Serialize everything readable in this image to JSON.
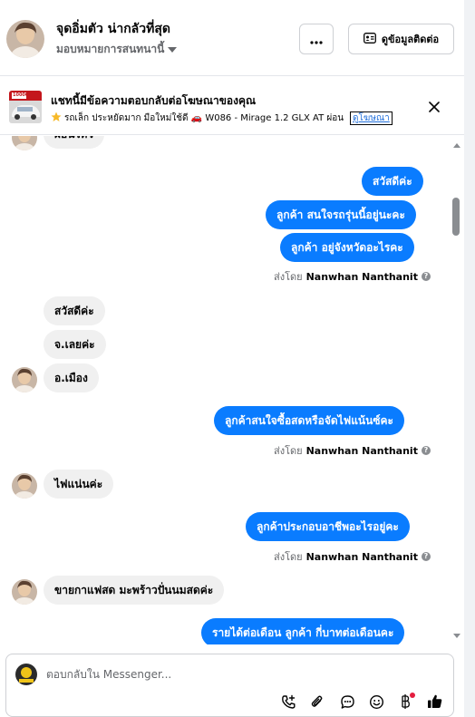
{
  "header": {
    "contact_name": "จุดอิ่มตัว น่ากลัวที่สุด",
    "assign_label": "มอบหมายการสนทนานี้",
    "more_label": "···",
    "contact_info_label": "ดูข้อมูลติดต่อ"
  },
  "ad_banner": {
    "title": "แชทนี้มีข้อความตอบกลับต่อโฆษณาของคุณ",
    "description": "รถเล็ก ประหยัดมาก มือใหม่ใช้ดี 🚗 W086 - Mirage 1.2 GLX AT ผ่อน ...",
    "link_label": "ดูโฆษณา",
    "thumb_text": "10000"
  },
  "messages": [
    {
      "id": "m0",
      "dir": "in",
      "text": "ผ่อนไหว"
    },
    {
      "id": "m1",
      "dir": "out",
      "text": "สวัสดีค่ะ"
    },
    {
      "id": "m2",
      "dir": "out",
      "text": "ลูกค้า สนใจรถรุ่นนี้อยู่นะคะ"
    },
    {
      "id": "m3",
      "dir": "out",
      "text": "ลูกค้า อยู่จังหวัดอะไรคะ"
    },
    {
      "id": "m4",
      "dir": "in",
      "text": "สวัสดีค่ะ"
    },
    {
      "id": "m5",
      "dir": "in",
      "text": "จ.เลยค่ะ"
    },
    {
      "id": "m6",
      "dir": "in",
      "text": "อ.เมือง"
    },
    {
      "id": "m7",
      "dir": "out",
      "text": "ลูกค้าสนใจซื้อสดหรือจัดไฟแน้นซ์คะ"
    },
    {
      "id": "m8",
      "dir": "in",
      "text": "ไฟแน่นค่ะ"
    },
    {
      "id": "m9",
      "dir": "out",
      "text": "ลูกค้าประกอบอาชีพอะไรอยู่คะ"
    },
    {
      "id": "m10",
      "dir": "in",
      "text": "ขายกาแฟสด มะพร้าวปั่นนมสดค่ะ"
    },
    {
      "id": "m11",
      "dir": "out",
      "text": "รายได้ต่อเดือน ลูกค้า กี่บาทต่อเดือนคะ"
    }
  ],
  "sent_by": {
    "prefix": "ส่งโดย",
    "sender": "Nanwhan Nanthanit"
  },
  "composer": {
    "placeholder": "ตอบกลับใน Messenger..."
  },
  "icons": {
    "more": "more-icon",
    "contact_card": "contact-card-icon",
    "close": "close-icon",
    "star": "star-icon",
    "phone_add": "phone-plus-icon",
    "attach": "paperclip-icon",
    "chat": "chat-bubble-icon",
    "emoji": "smiley-icon",
    "baht": "baht-icon",
    "like": "thumbs-up-icon"
  },
  "colors": {
    "outgoing_bubble": "#0a7cff",
    "incoming_bubble": "#f0f0f0",
    "notification_dot": "#e41e3f"
  }
}
